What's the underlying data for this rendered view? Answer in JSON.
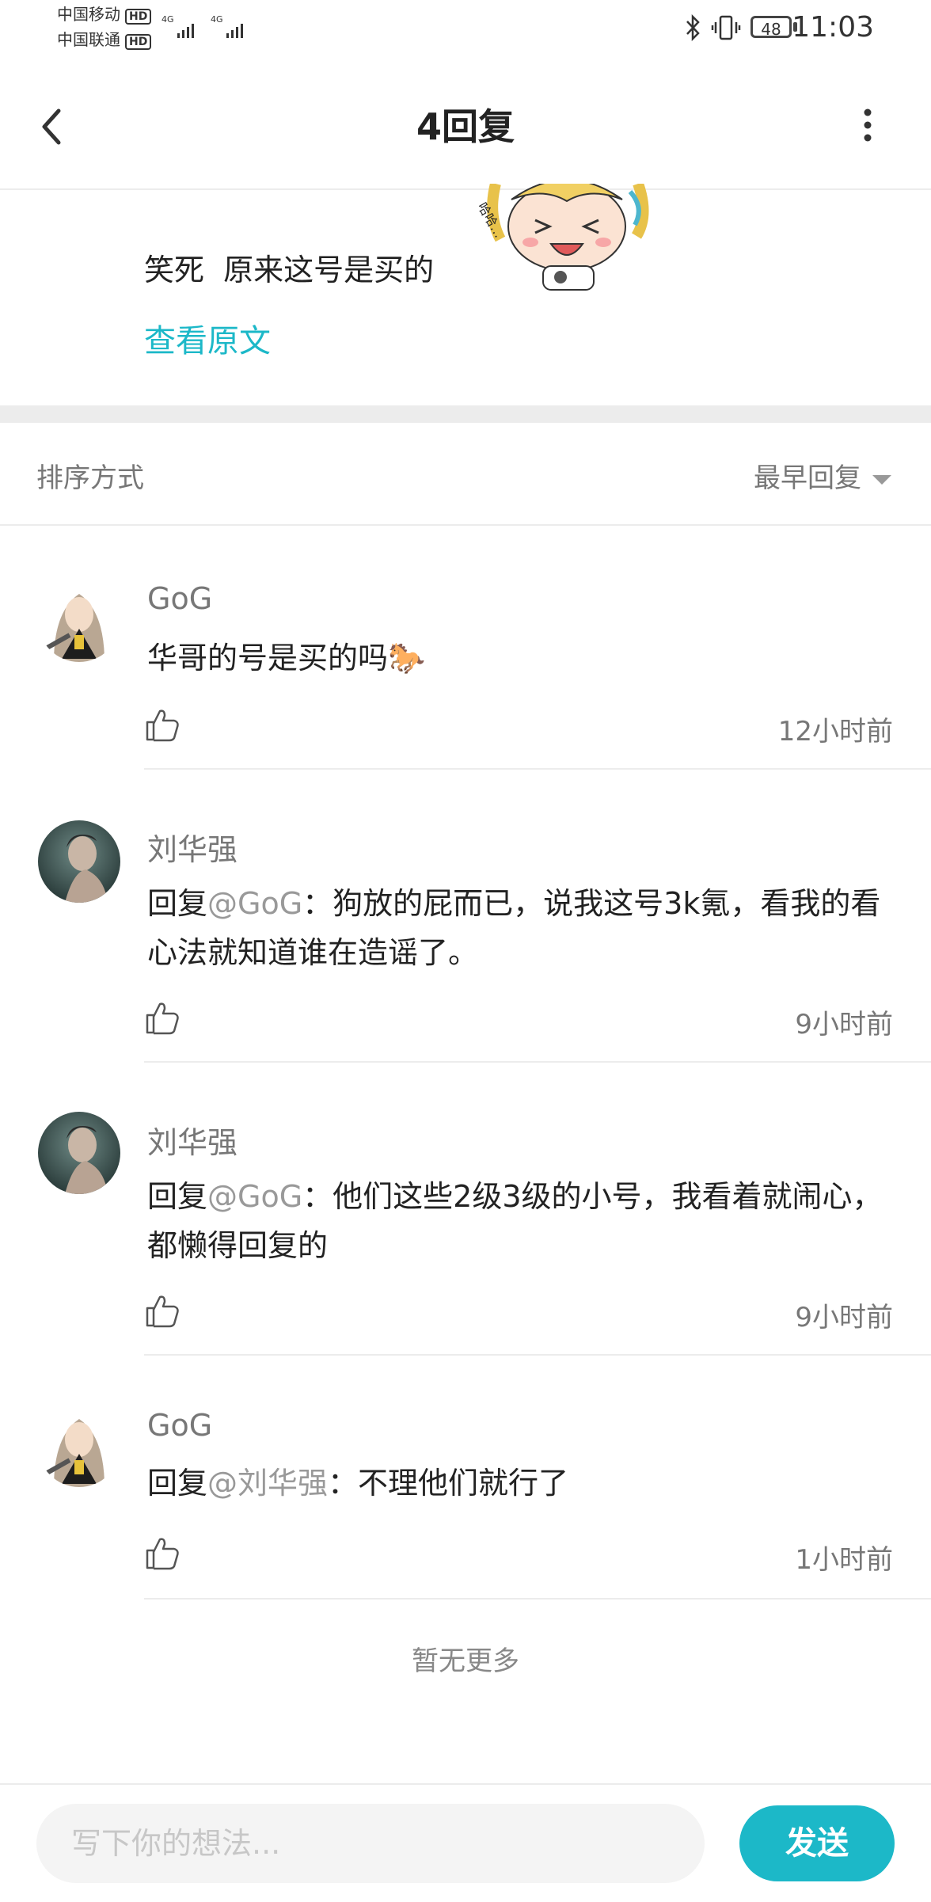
{
  "status": {
    "carrier1": "中国移动",
    "carrier2": "中国联通",
    "hd": "HD",
    "net": "4G",
    "battery": "48",
    "time": "11:03"
  },
  "header": {
    "title": "4回复"
  },
  "original": {
    "text": "笑死  原来这号是买的",
    "view_original": "查看原文",
    "sticker_text": "哈哈…"
  },
  "sort": {
    "label": "排序方式",
    "value": "最早回复"
  },
  "replies": [
    {
      "name": "GoG",
      "text": "华哥的号是买的吗",
      "emoji": "🐎",
      "time": "12小时前"
    },
    {
      "name": "刘华强",
      "prefix": "回复",
      "mention": "@GoG",
      "text": "：狗放的屁而已，说我这号3k氪，看我的看心法就知道谁在造谣了。",
      "time": "9小时前"
    },
    {
      "name": "刘华强",
      "prefix": "回复",
      "mention": "@GoG",
      "text": "：他们这些2级3级的小号，我看着就闹心，都懒得回复的",
      "time": "9小时前"
    },
    {
      "name": "GoG",
      "prefix": "回复",
      "mention": "@刘华强",
      "text": "：不理他们就行了",
      "time": "1小时前"
    }
  ],
  "footer": {
    "no_more": "暂无更多"
  },
  "composer": {
    "placeholder": "写下你的想法...",
    "send": "发送"
  },
  "colors": {
    "accent": "#1cb8c8",
    "muted": "#777777",
    "mention": "#999999"
  }
}
